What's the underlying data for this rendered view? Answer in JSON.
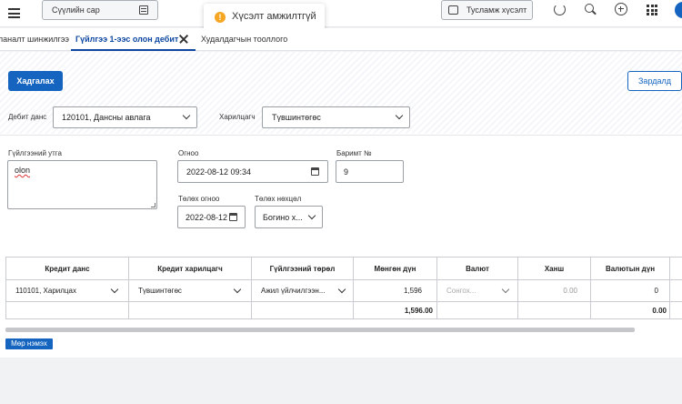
{
  "topbar": {
    "menu_icon": "hamburger-icon",
    "search_placeholder": "Сүүлийн сар",
    "help_button": "Тусламж хүсэлт"
  },
  "toast": {
    "message": "Хүсэлт амжилтгүй",
    "color": "#f5a623"
  },
  "tabs": [
    {
      "label": "Баланалт шинжилгээ"
    },
    {
      "label": "Гүйлгээ 1-ээс олон дебит",
      "active": true
    },
    {
      "label": "Худалдагчын тооллого"
    }
  ],
  "actions": {
    "save": "Хадгалах",
    "expense": "Зардалд"
  },
  "form": {
    "debit_label": "Дебит данс",
    "debit_value": "120101, Дансны авлага",
    "partner_label": "Харилцагч",
    "partner_value": "Түвшинтөгөс",
    "desc_label": "Гүйлгээний утга",
    "desc_value": "olon",
    "date_label": "Огноо",
    "date_value": "2022-08-12 09:34",
    "doc_label": "Баримт №",
    "doc_value": "9",
    "paydate_label": "Төлөх огноо",
    "paydate_value": "2022-08-12",
    "payterm_label": "Төлөх нөхцөл",
    "payterm_value": "Богино х..."
  },
  "grid": {
    "headers": [
      "Кредит данс",
      "Кредит харилцагч",
      "Гүйлгээний төрөл",
      "Мөнгөн дүн",
      "Валют",
      "Ханш",
      "Валютын дүн"
    ],
    "row": {
      "credit_account": "110101, Харилцах",
      "credit_partner": "Түвшинтөгөс",
      "tx_type": "Ажил үйлчилгээн...",
      "amount": "1,596",
      "currency_placeholder": "Сонгох...",
      "rate": "0.00",
      "fx_amount": "0"
    },
    "totals": {
      "amount": "1,596.00",
      "fx_amount": "0.00"
    }
  },
  "add_row": "Мөр нэмэх",
  "colors": {
    "accent": "#1565c0",
    "warning": "#f5a623"
  }
}
